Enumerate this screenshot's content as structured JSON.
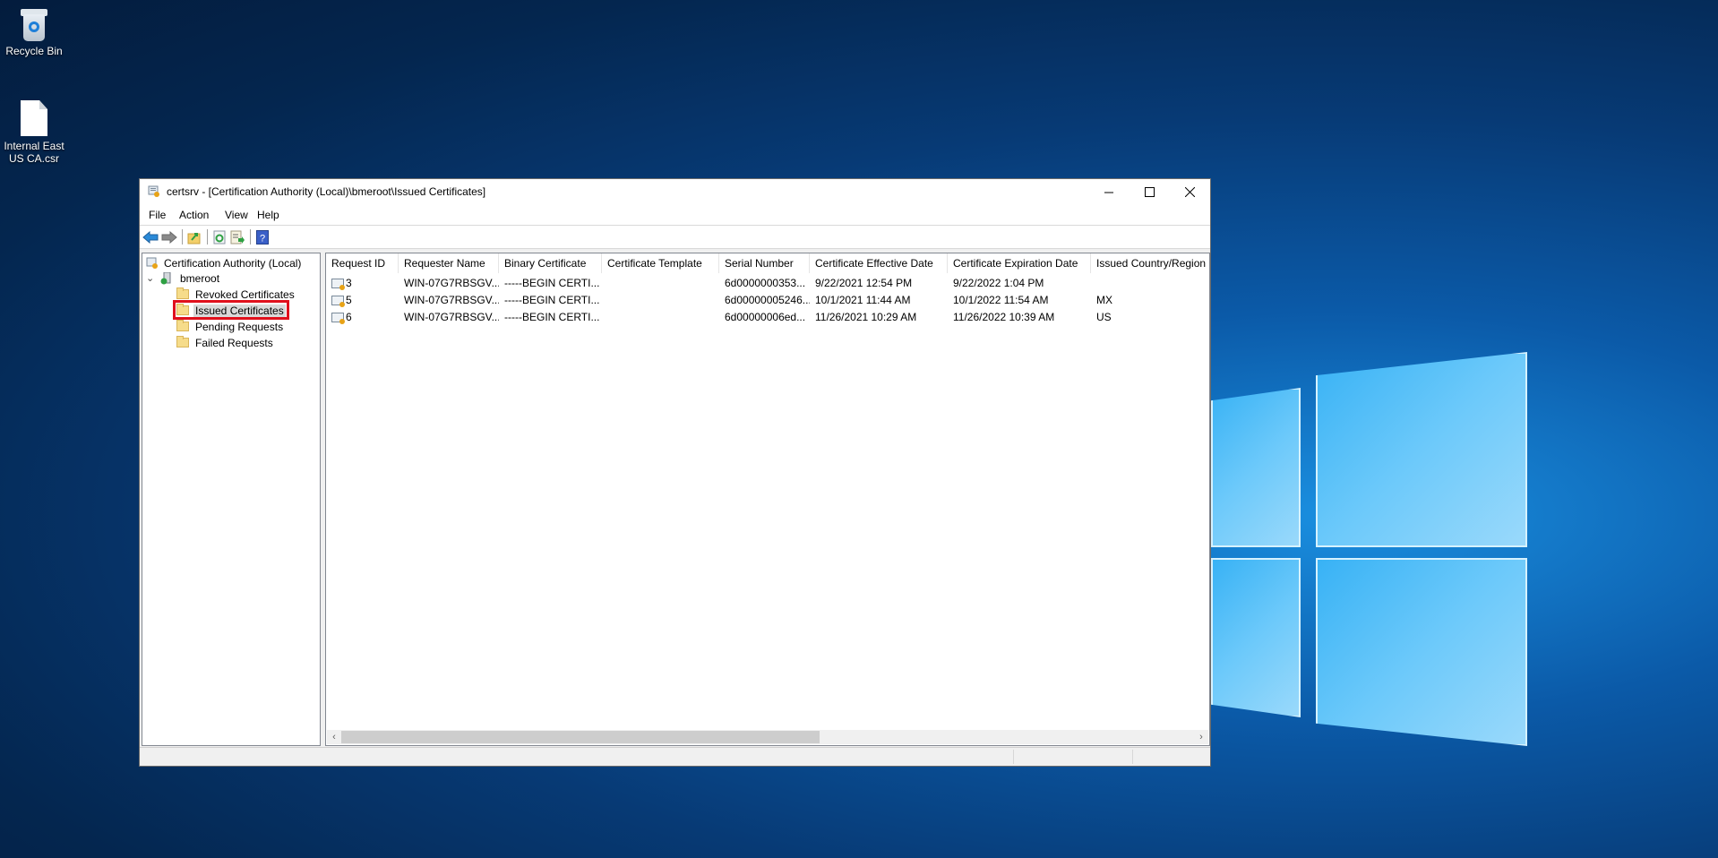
{
  "desktop": {
    "icons": [
      {
        "label": "Recycle Bin",
        "icon": "recycle-bin-icon"
      },
      {
        "label": "Internal East US CA.csr",
        "icon": "file-icon"
      }
    ]
  },
  "window": {
    "title": "certsrv - [Certification Authority (Local)\\bmeroot\\Issued Certificates]",
    "controls": {
      "minimize": "─",
      "maximize": "☐",
      "close": "✕"
    }
  },
  "menu": [
    "File",
    "Action",
    "View",
    "Help"
  ],
  "toolbar": [
    {
      "name": "back",
      "icon": "back-arrow-icon"
    },
    {
      "name": "forward",
      "icon": "forward-arrow-icon"
    },
    {
      "name": "up-one-level",
      "icon": "up-folder-icon"
    },
    {
      "name": "refresh",
      "icon": "refresh-icon"
    },
    {
      "name": "export-list",
      "icon": "export-list-icon"
    },
    {
      "name": "help",
      "icon": "help-icon",
      "glyph": "?"
    }
  ],
  "tree": {
    "root": "Certification Authority (Local)",
    "ca": "bmeroot",
    "expander": "⌄",
    "children": [
      "Revoked Certificates",
      "Issued Certificates",
      "Pending Requests",
      "Failed Requests"
    ],
    "selected": "Issued Certificates"
  },
  "list": {
    "columns": [
      "Request ID",
      "Requester Name",
      "Binary Certificate",
      "Certificate Template",
      "Serial Number",
      "Certificate Effective Date",
      "Certificate Expiration Date",
      "Issued Country/Region"
    ],
    "rows": [
      [
        "3",
        "WIN-07G7RBSGV...",
        "-----BEGIN CERTI...",
        "",
        "6d0000000353...",
        "9/22/2021 12:54 PM",
        "9/22/2022 1:04 PM",
        ""
      ],
      [
        "5",
        "WIN-07G7RBSGV...",
        "-----BEGIN CERTI...",
        "",
        "6d00000005246...",
        "10/1/2021 11:44 AM",
        "10/1/2022 11:54 AM",
        "MX"
      ],
      [
        "6",
        "WIN-07G7RBSGV...",
        "-----BEGIN CERTI...",
        "",
        "6d00000006ed...",
        "11/26/2021 10:29 AM",
        "11/26/2022 10:39 AM",
        "US"
      ]
    ],
    "scroll": {
      "left_arrow": "‹",
      "right_arrow": "›",
      "thumb_start_fraction": 0.0,
      "visible_fraction": 0.56
    }
  },
  "colors": {
    "highlight_box": "#e0101c",
    "selected_bg": "#d9d9d9"
  }
}
